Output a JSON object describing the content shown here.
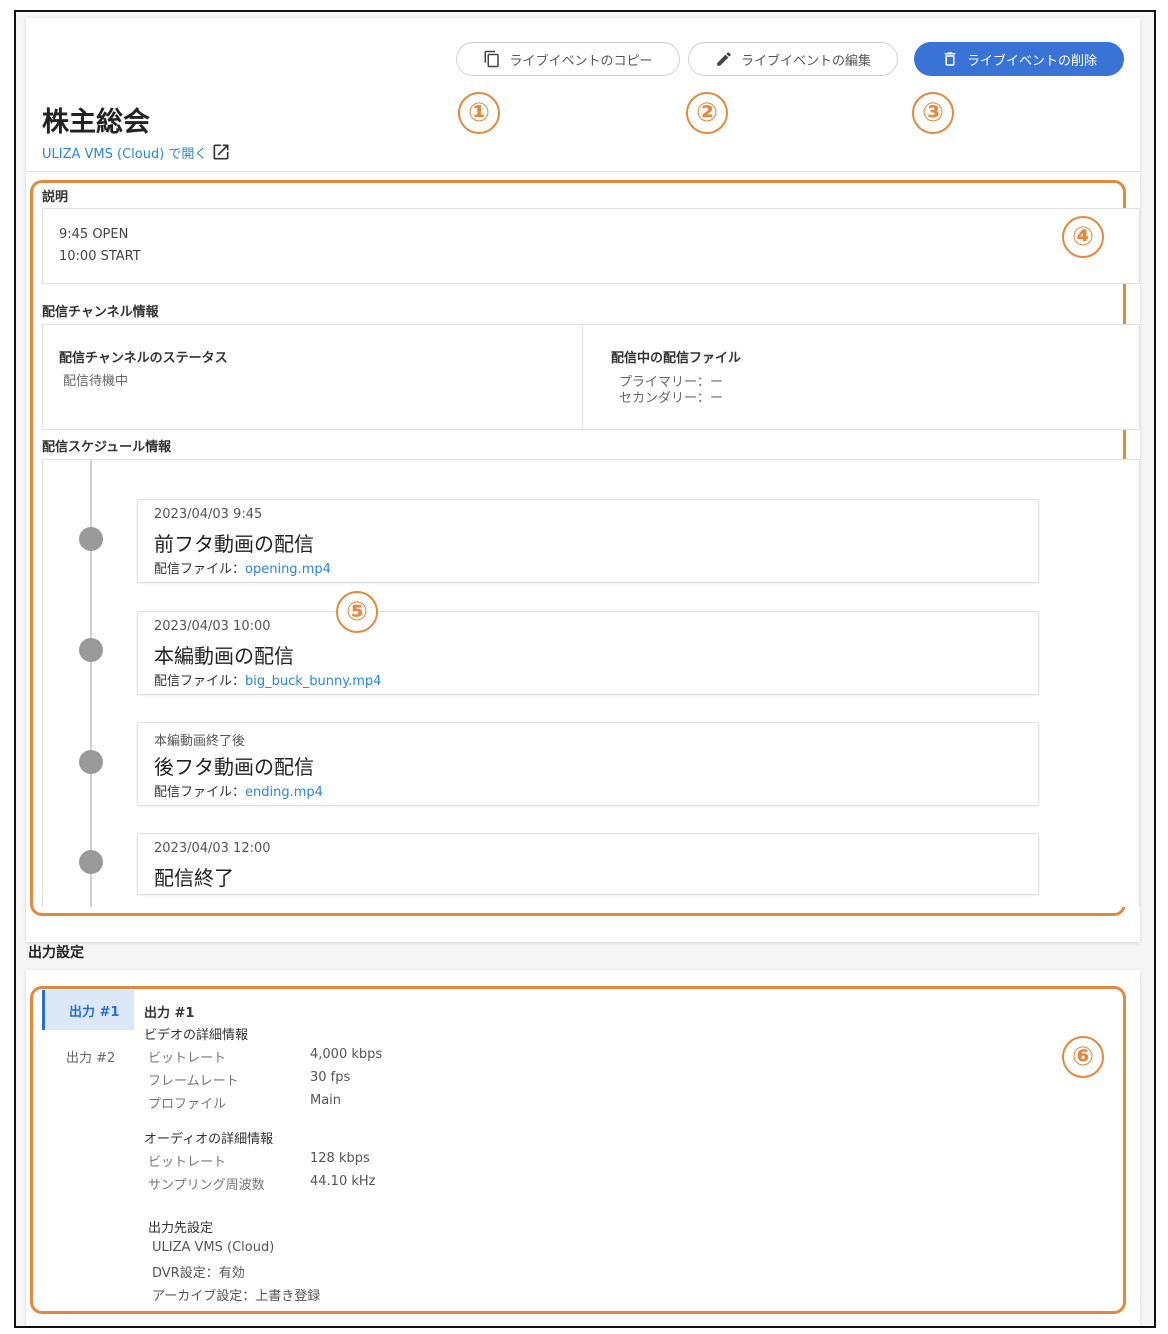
{
  "header": {
    "title": "株主総会",
    "open_link": "ULIZA VMS (Cloud) で開く",
    "buttons": {
      "copy": "ライブイベントのコピー",
      "edit": "ライブイベントの編集",
      "delete": "ライブイベントの削除"
    }
  },
  "markers": [
    "①",
    "②",
    "③",
    "④",
    "⑤",
    "⑥"
  ],
  "description": {
    "label": "説明",
    "lines": [
      "9:45 OPEN",
      "10:00 START"
    ]
  },
  "channel": {
    "label": "配信チャンネル情報",
    "status_title": "配信チャンネルのステータス",
    "status_value": "配信待機中",
    "files_title": "配信中の配信ファイル",
    "primary": "プライマリー：ー",
    "secondary": "セカンダリー：ー"
  },
  "schedule": {
    "label": "配信スケジュール情報",
    "items": [
      {
        "date": "2023/04/03 9:45",
        "name": "前フタ動画の配信",
        "file_label": "配信ファイル：",
        "file": "opening.mp4"
      },
      {
        "date": "2023/04/03 10:00",
        "name": "本編動画の配信",
        "file_label": "配信ファイル：",
        "file": "big_buck_bunny.mp4"
      },
      {
        "date": "本編動画終了後",
        "name": "後フタ動画の配信",
        "file_label": "配信ファイル：",
        "file": "ending.mp4"
      },
      {
        "date": "2023/04/03 12:00",
        "name": "配信終了"
      }
    ]
  },
  "output": {
    "label": "出力設定",
    "tabs": [
      "出力 #1",
      "出力 #2"
    ],
    "heading": "出力 #1",
    "video": {
      "title": "ビデオの詳細情報",
      "rows": [
        {
          "key": "ビットレート",
          "value": "4,000 kbps"
        },
        {
          "key": "フレームレート",
          "value": "30 fps"
        },
        {
          "key": "プロファイル",
          "value": "Main"
        }
      ]
    },
    "audio": {
      "title": "オーディオの詳細情報",
      "rows": [
        {
          "key": "ビットレート",
          "value": "128 kbps"
        },
        {
          "key": "サンプリング周波数",
          "value": "44.10 kHz"
        }
      ]
    },
    "destination": {
      "title": "出力先設定",
      "lines": [
        "ULIZA VMS (Cloud)",
        "DVR設定：有効",
        "アーカイブ設定：上書き登録"
      ]
    }
  },
  "colors": {
    "accent": "#3a73d6",
    "link": "#2a86d6",
    "annotation": "#e0893f"
  }
}
